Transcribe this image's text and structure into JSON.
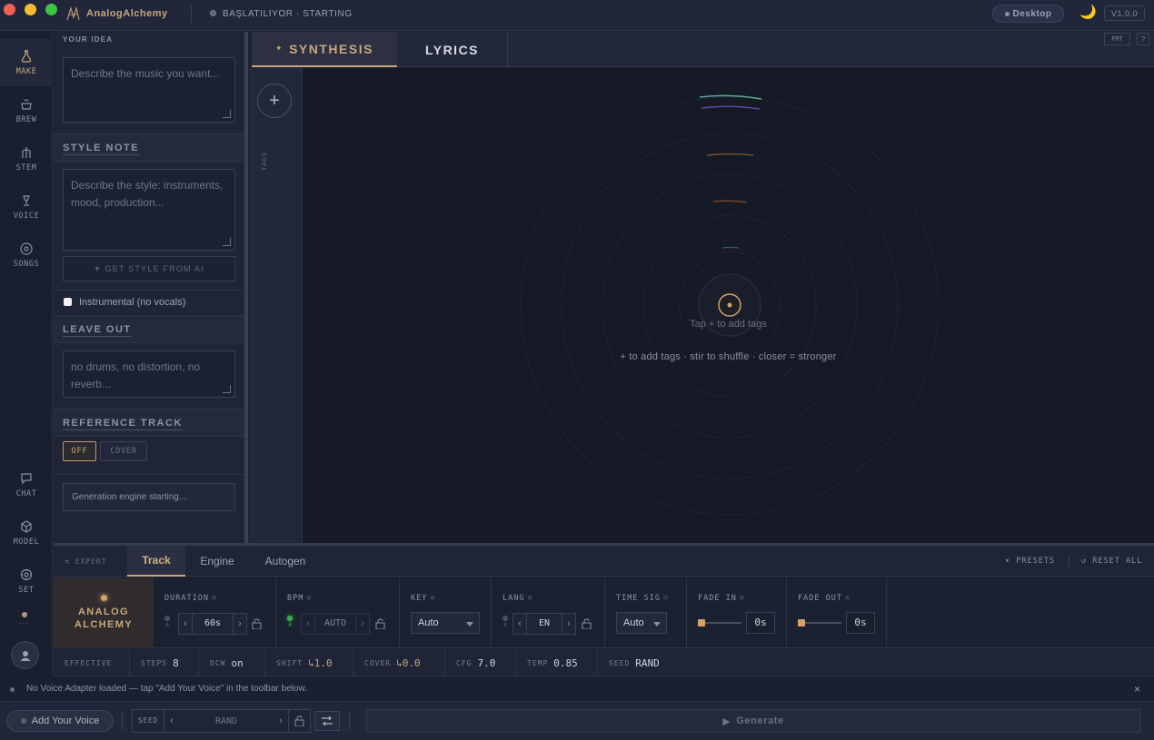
{
  "app": {
    "name": "AnalogAlchemy",
    "status": "BAŞLATILIYOR · STARTING",
    "mode_button": "Desktop",
    "version": "V1.0.0"
  },
  "sidebar": {
    "top_items": [
      {
        "label": "MAKE",
        "icon": "flask-icon"
      },
      {
        "label": "BREW",
        "icon": "cauldron-icon"
      },
      {
        "label": "STEM",
        "icon": "stem-icon"
      },
      {
        "label": "VOICE",
        "icon": "microphone-icon"
      },
      {
        "label": "SONGS",
        "icon": "disc-icon"
      }
    ],
    "bottom_items": [
      {
        "label": "CHAT",
        "icon": "chat-icon"
      },
      {
        "label": "MODEL",
        "icon": "cube-icon"
      },
      {
        "label": "SET",
        "icon": "settings-icon"
      }
    ],
    "more": "···"
  },
  "left_panel": {
    "your_idea": {
      "label": "YOUR IDEA",
      "placeholder": "Describe the music you want..."
    },
    "style_note": {
      "label": "STYLE NOTE",
      "placeholder": "Describe the style: instruments, mood, production...",
      "ai_button": "✦ GET STYLE FROM AI"
    },
    "instrumental": {
      "label": "Instrumental (no vocals)",
      "checked": false
    },
    "leave_out": {
      "label": "LEAVE OUT",
      "placeholder": "no drums, no distortion, no reverb..."
    },
    "reference": {
      "label": "REFERENCE TRACK",
      "off": "OFF",
      "cover": "COVER",
      "selected": "OFF"
    },
    "engine_status": "Generation engine starting..."
  },
  "center": {
    "tabs": [
      {
        "label": "SYNTHESIS",
        "icon": "✦"
      },
      {
        "label": "LYRICS"
      }
    ],
    "fmt": "FMT",
    "help": "?",
    "tags_label": "TAGS",
    "add_tag": "+",
    "tap_hint": "Tap + to add tags",
    "bottom_hint": "+ to add tags · stir to shuffle · closer = stronger"
  },
  "expert": {
    "label": "⚗ EXPERT",
    "tabs": [
      "Track",
      "Engine",
      "Autogen"
    ],
    "active_tab": "Track",
    "presets": "▾ PRESETS",
    "reset": "↺ RESET ALL",
    "brand": "ANALOG ALCHEMY",
    "params": {
      "duration": {
        "label": "DURATION",
        "value": "60s"
      },
      "bpm": {
        "label": "BPM",
        "value": "AUTO"
      },
      "key": {
        "label": "KEY",
        "value": "Auto"
      },
      "lang": {
        "label": "LANG",
        "value": "EN"
      },
      "time_sig": {
        "label": "TIME SIG",
        "value": "Auto"
      },
      "fade_in": {
        "label": "FADE IN",
        "value": "0s"
      },
      "fade_out": {
        "label": "FADE OUT",
        "value": "0s"
      }
    },
    "auto_marker": "A",
    "info_glyph": "⊙"
  },
  "effective": {
    "label": "EFFECTIVE",
    "items": [
      {
        "key": "STEPS",
        "value": "8"
      },
      {
        "key": "DCW",
        "value": "on"
      },
      {
        "key": "SHIFT",
        "value": "↳1.0"
      },
      {
        "key": "COVER",
        "value": "↳0.0"
      },
      {
        "key": "CFG",
        "value": "7.0"
      },
      {
        "key": "TEMP",
        "value": "0.85"
      },
      {
        "key": "SEED",
        "value": "RAND"
      }
    ]
  },
  "notice": {
    "text": "No Voice Adapter loaded — tap \"Add Your Voice\" in the toolbar below.",
    "close": "×"
  },
  "bottom": {
    "add_voice": "Add Your Voice",
    "seed": {
      "label": "SEED",
      "value": "RAND"
    },
    "generate": "Generate"
  },
  "colors": {
    "accent": "#c9a77c",
    "bg": "#1d2233",
    "canvas": "#161a26"
  }
}
